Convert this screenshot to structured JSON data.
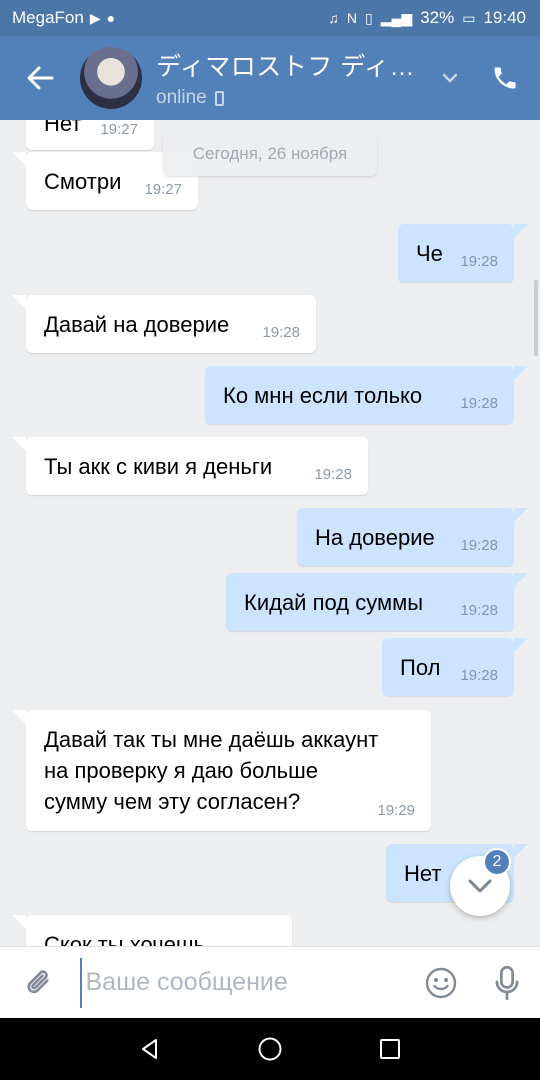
{
  "statusbar": {
    "carrier": "MegaFon",
    "battery": "32%",
    "time": "19:40"
  },
  "header": {
    "name": "ディマロストフ ディマ…",
    "status": "online"
  },
  "chat": {
    "date_separator": "Сегодня, 26 ноября",
    "messages": [
      {
        "dir": "in",
        "text": "Нет",
        "time": "19:27"
      },
      {
        "dir": "in",
        "text": "Смотри",
        "time": "19:27"
      },
      {
        "dir": "out",
        "text": "Че",
        "time": "19:28"
      },
      {
        "dir": "in",
        "text": "Давай на доверие",
        "time": "19:28"
      },
      {
        "dir": "out",
        "text": "Ко мнн если только",
        "time": "19:28"
      },
      {
        "dir": "in",
        "text": "Ты акк с киви я деньги",
        "time": "19:28"
      },
      {
        "dir": "out",
        "text": "На доверие",
        "time": "19:28"
      },
      {
        "dir": "out",
        "text": "Кидай под суммы",
        "time": "19:28"
      },
      {
        "dir": "out",
        "text": "Пол",
        "time": "19:28"
      },
      {
        "dir": "in",
        "text": "Давай так ты мне даёшь аккаунт\nна проверку я даю больше\nсумму чем эту согласен?",
        "time": "19:29"
      },
      {
        "dir": "out",
        "text": "Нет",
        "time": ""
      },
      {
        "dir": "in",
        "text": "Скок ты хочешь",
        "time": ""
      }
    ],
    "unread_count": "2"
  },
  "composer": {
    "placeholder": "Ваше сообщение"
  },
  "colors": {
    "header": "#5181b8",
    "statusbar": "#4a76a8",
    "incoming": "#ffffff",
    "outgoing": "#cce4ff",
    "background": "#edeef0"
  }
}
